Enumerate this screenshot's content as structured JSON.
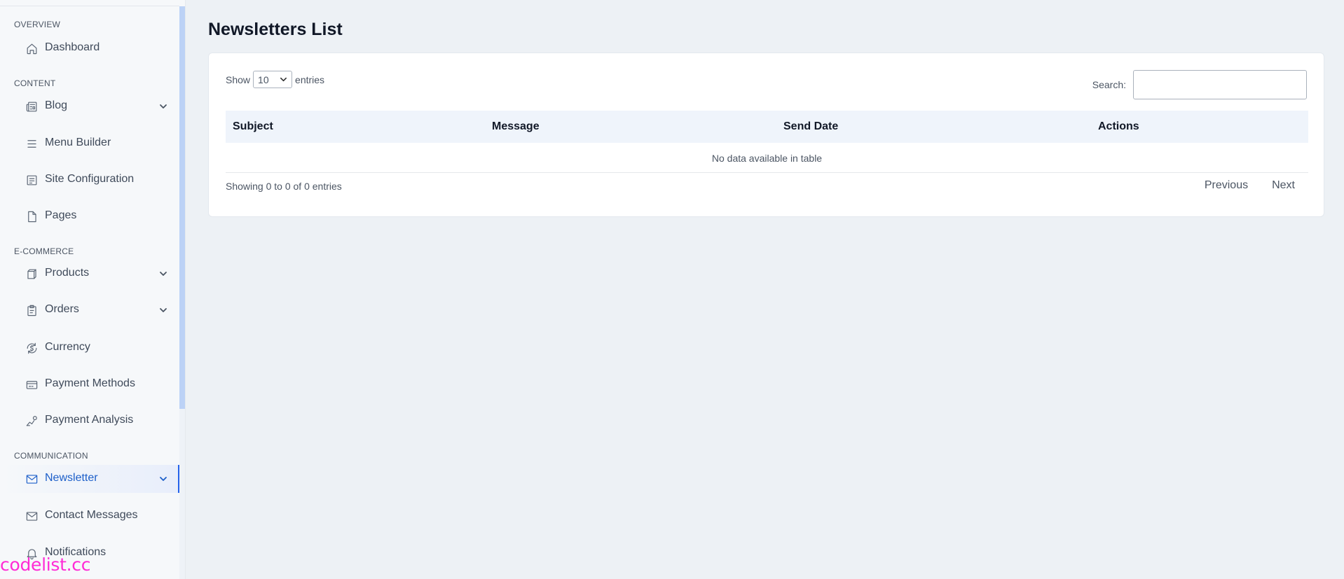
{
  "sidebar": {
    "sections": {
      "overview": "OVERVIEW",
      "content": "CONTENT",
      "ecommerce": "E-COMMERCE",
      "communication": "COMMUNICATION"
    },
    "items": {
      "dashboard": "Dashboard",
      "blog": "Blog",
      "menu_builder": "Menu Builder",
      "site_configuration": "Site Configuration",
      "pages": "Pages",
      "products": "Products",
      "orders": "Orders",
      "currency": "Currency",
      "payment_methods": "Payment Methods",
      "payment_analysis": "Payment Analysis",
      "newsletter": "Newsletter",
      "contact_messages": "Contact Messages",
      "notifications": "Notifications"
    },
    "active_item": "Newsletter",
    "icons": {
      "dashboard": "home-icon",
      "blog": "newspaper-icon",
      "menu_builder": "menu-icon",
      "site_configuration": "document-settings-icon",
      "pages": "file-icon",
      "products": "box-icon",
      "orders": "clipboard-icon",
      "currency": "currency-exchange-icon",
      "payment_methods": "credit-card-icon",
      "payment_analysis": "chart-search-icon",
      "newsletter": "mail-icon",
      "contact_messages": "mail-icon",
      "notifications": "bell-icon"
    }
  },
  "main": {
    "title": "Newsletters List",
    "length": {
      "prefix": "Show",
      "value": "10",
      "suffix": "entries"
    },
    "search": {
      "label": "Search:",
      "value": ""
    },
    "table": {
      "columns": [
        "Subject",
        "Message",
        "Send Date",
        "Actions"
      ],
      "empty_message": "No data available in table"
    },
    "info": "Showing 0 to 0 of 0 entries",
    "pagination": {
      "previous": "Previous",
      "next": "Next"
    }
  },
  "watermark": "codelist.cc",
  "colors": {
    "accent": "#1d5fc9",
    "background": "#edf1f5",
    "sidebar": "#f6f8fa",
    "watermark": "#ff2bd6"
  }
}
